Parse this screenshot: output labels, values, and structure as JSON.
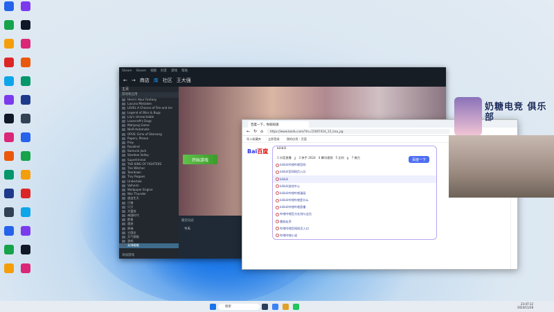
{
  "steam": {
    "logo": "Steam",
    "menu": [
      "Steam",
      "视图",
      "好友",
      "游戏",
      "帮助"
    ],
    "nav": {
      "store": "商店",
      "library": "库",
      "community": "社区",
      "user": "王大强"
    },
    "home": "主页",
    "filter": "游戏和应用",
    "games": [
      "Hero's Hour Fantasy",
      "Lacuna Mistaken",
      "LEVEL A Chance of Fire and Ice",
      "Legend of Bliss & Bugs",
      "Lily's Unreachable",
      "Lovecraft's Dogs",
      "Mahjong Game",
      "NieR:Automata",
      "OPUS: Echo of Starsong",
      "Papers, Please",
      "Prey",
      "Rosalind",
      "Samurai Jack",
      "Stardew Valley",
      "Superliminal",
      "THE KING OF FIGHTERS",
      "The Witcher",
      "Teardown",
      "Tiny Rogues",
      "Undertale",
      "Valheim",
      "Wallpaper Engine",
      "War Thunder",
      "逃出生天",
      "只狼",
      "只只",
      "大富翁",
      "帝国时代",
      "斯普",
      "遗迹",
      "原神",
      "三国志",
      "天气预报",
      "游戏"
    ],
    "selected_game": "无限暖暖",
    "play_button": "开始游戏",
    "news_title": "最近动态",
    "news_day": "今天",
    "bottom": "添加游戏"
  },
  "browser": {
    "tab_title": "百度一下，你就知道",
    "url": "https://www.baidu.com/?tn=15007414_15_hao_pg",
    "bookmarks": [
      "导入收藏夹",
      "立即登录",
      "我的应用 - 百度"
    ],
    "logo_text": "Bai",
    "logo_du": "百度",
    "query": "bilibili",
    "hot": [
      "1 抖音直播",
      "2",
      "3 快手 2024",
      "4 腾讯视频",
      "5 比利",
      "6",
      "7 微力"
    ],
    "search_button": "百度一下",
    "suggestions": [
      "bilibili哔哩哔哩官网",
      "bilibili官网网页入口",
      "bilibili",
      "bilibili游戏中心",
      "bilibili哔哩哔哩漫画",
      "bilibili哔哩哔哩是什么",
      "bilibili哔哩哔哩直播",
      "哔哩哔哩官方在线与会员",
      "番剧走资",
      "哔哩哔哩官网网页入口",
      "哔哩哔哩小说"
    ]
  },
  "overlay": {
    "banner_title": "奶糖电竞 俱乐部"
  },
  "taskbar": {
    "search": "搜索",
    "time": "23:47:12",
    "date": "2024/11/28"
  }
}
